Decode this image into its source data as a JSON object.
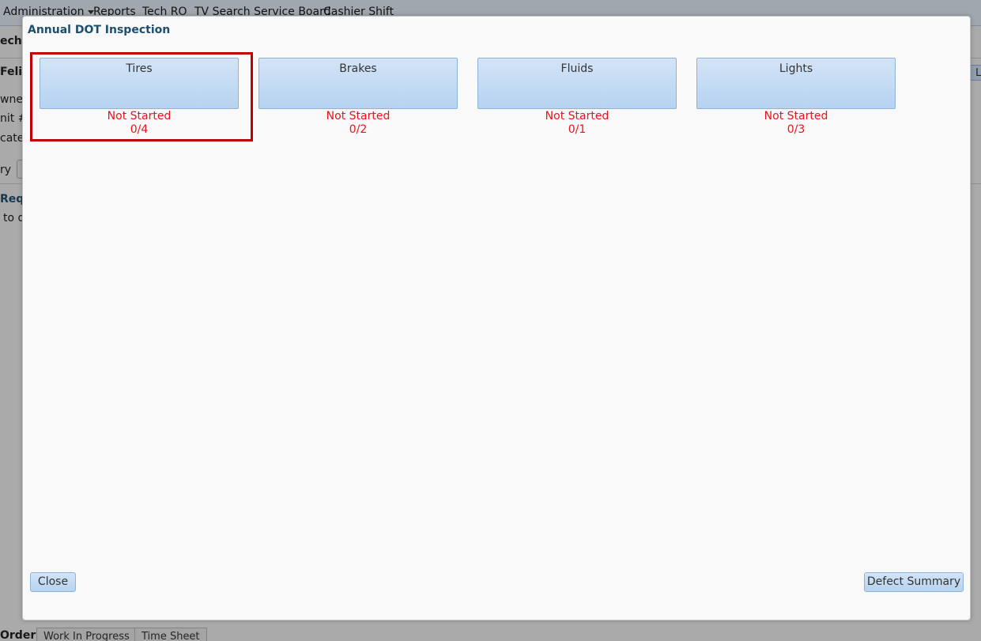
{
  "background": {
    "menu": [
      "Administration",
      "Reports",
      "Tech RO",
      "TV Search Service Board",
      "Cashier Shift"
    ],
    "fragments": [
      "ech",
      "Felix",
      "wner",
      "nit #",
      "cate",
      "ry",
      "Requ",
      "to d"
    ],
    "right_button_text": "L",
    "bottom_tabs": [
      "Order",
      "Work In Progress",
      "Time Sheet"
    ]
  },
  "dialog": {
    "title": "Annual DOT Inspection",
    "categories": [
      {
        "label": "Tires",
        "status": "Not Started",
        "progress": "0/4"
      },
      {
        "label": "Brakes",
        "status": "Not Started",
        "progress": "0/2"
      },
      {
        "label": "Fluids",
        "status": "Not Started",
        "progress": "0/1"
      },
      {
        "label": "Lights",
        "status": "Not Started",
        "progress": "0/3"
      }
    ],
    "close_label": "Close",
    "defect_summary_label": "Defect Summary"
  },
  "colors": {
    "status_text": "#e8141a",
    "highlight": "#c00000",
    "title": "#1e4e6e"
  }
}
